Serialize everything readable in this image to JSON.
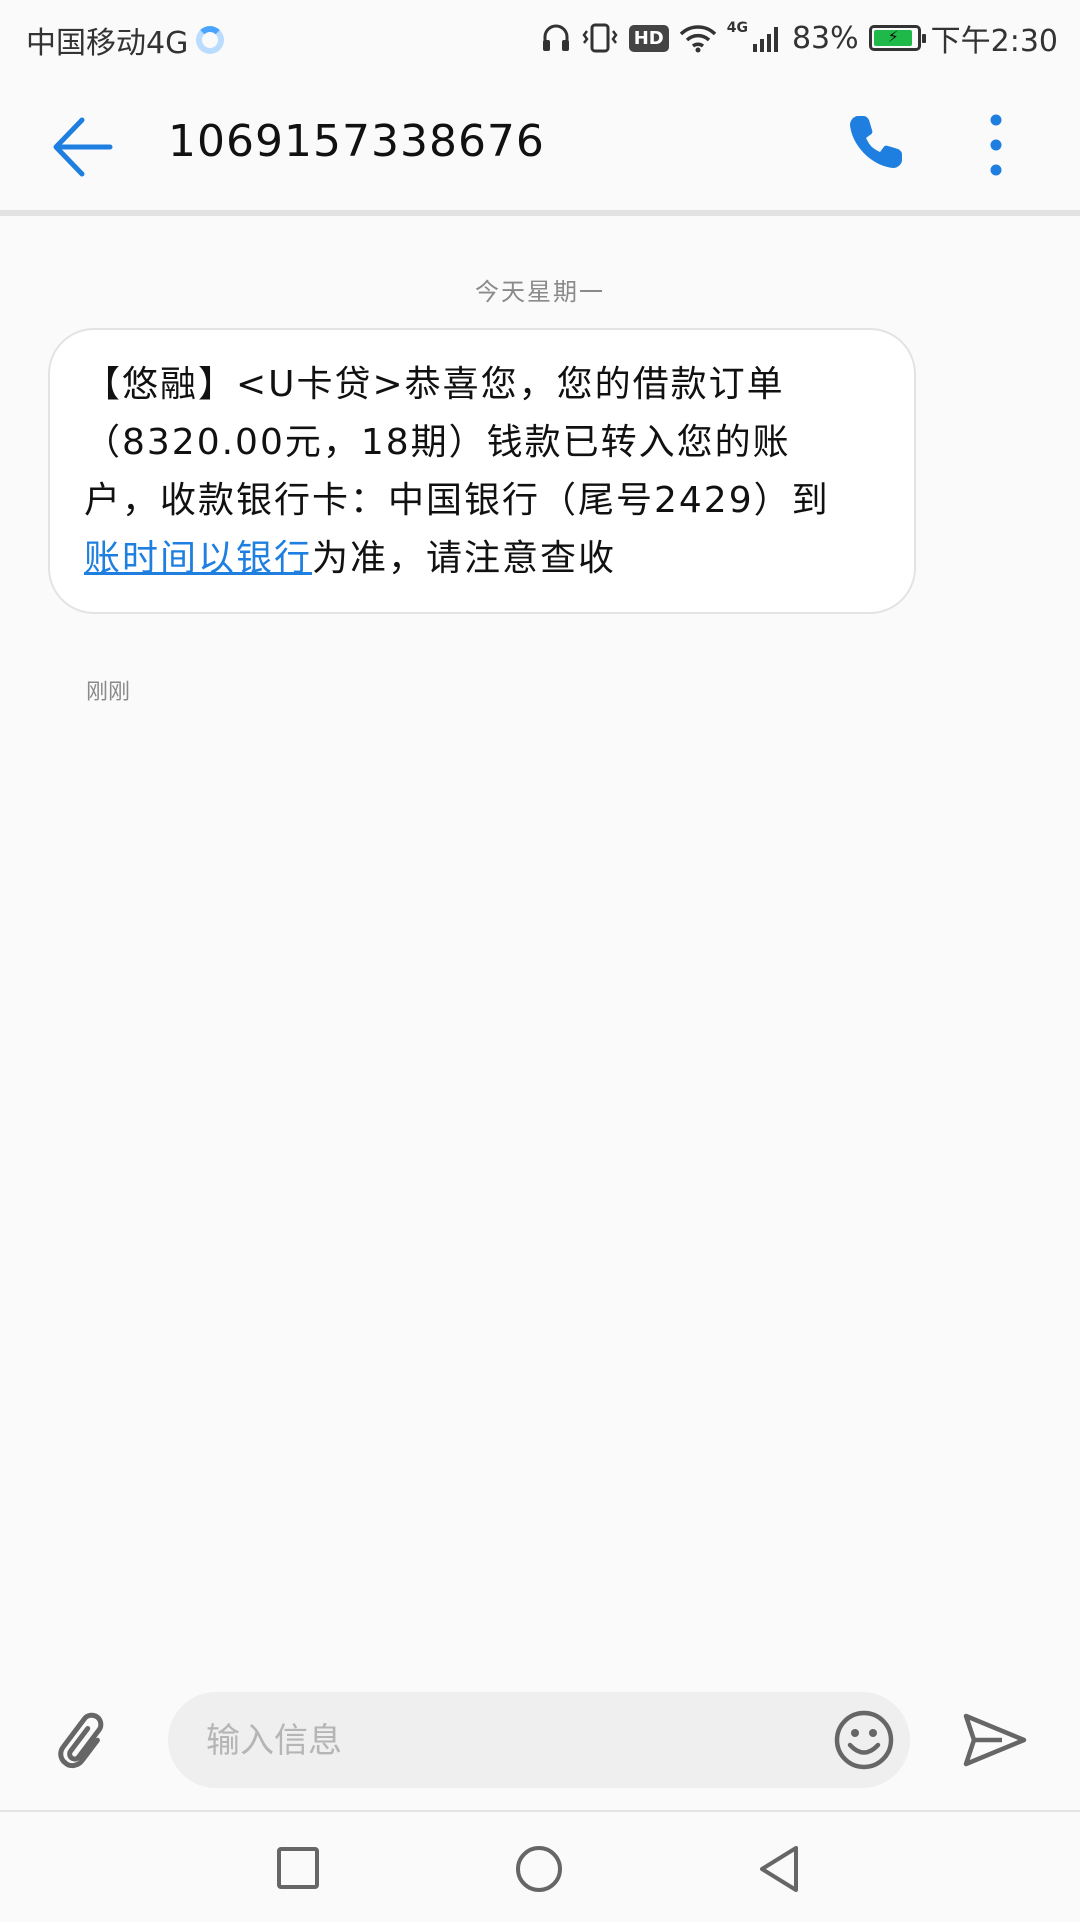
{
  "status_bar": {
    "carrier": "中国移动4G",
    "network_badge": "4G",
    "hd_badge": "HD",
    "battery_percent": "83%",
    "battery_level": 0.83,
    "time": "下午2:30"
  },
  "header": {
    "title": "1069157338676"
  },
  "conversation": {
    "date_separator": "今天星期一",
    "message": {
      "text_before_link": "【悠融】<U卡贷>恭喜您，您的借款订单（8320.00元，18期）钱款已转入您的账户，收款银行卡：中国银行（尾号2429）到",
      "link_text": "账时间以银行",
      "text_after_link": "为准，请注意查收",
      "time": "刚刚"
    }
  },
  "composer": {
    "placeholder": "输入信息"
  },
  "colors": {
    "accent": "#1e7fe0",
    "battery": "#1fb94a",
    "background": "#fafafa"
  },
  "icons": {
    "back": "arrow-left",
    "call": "phone",
    "more": "more-vertical",
    "attach": "paperclip",
    "emoji": "smiley",
    "send": "paper-plane",
    "nav_recents": "square",
    "nav_home": "circle",
    "nav_back": "triangle"
  }
}
